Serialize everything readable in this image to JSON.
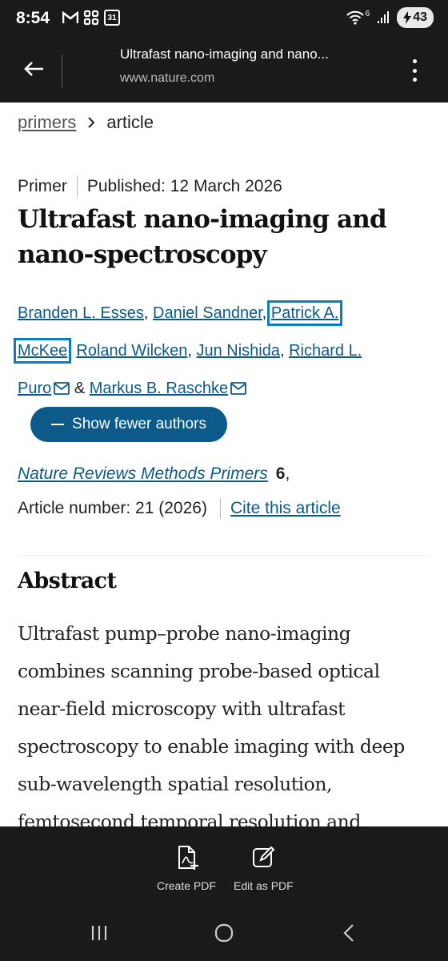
{
  "status_bar": {
    "time": "8:54",
    "left_icons": [
      "gmail-icon",
      "slack-icon",
      "calendar-icon"
    ],
    "calendar_day": "31",
    "signal_label": "6",
    "battery_level": "43"
  },
  "app_bar": {
    "title": "Ultrafast nano-imaging and nano...",
    "url": "www.nature.com"
  },
  "breadcrumb": {
    "parent": "primers",
    "current": "article"
  },
  "article": {
    "type": "Primer",
    "published": "Published: 12 March 2026",
    "title": "Ultrafast nano-imaging and nano-spectroscopy",
    "authors": [
      "Branden L. Esses",
      "Daniel Sandner",
      "Patrick A.",
      "McKee",
      "Roland Wilcken",
      "Jun Nishida",
      "Richard L.",
      "Puro",
      "Markus B. Raschke"
    ],
    "separators": {
      "comma": ",",
      "amp": "&"
    },
    "show_authors_label": "Show fewer authors",
    "journal": "Nature Reviews Methods Primers",
    "volume": "6",
    "volume_suffix": ",",
    "article_number": "Article number: 21 (2026)",
    "cite_label": "Cite this article"
  },
  "abstract": {
    "heading": "Abstract",
    "lines": [
      "Ultrafast pump–probe nano-imaging",
      "combines scanning probe-based optical",
      "near-field microscopy with ultrafast",
      "spectroscopy to enable imaging with deep",
      "sub-wavelength spatial resolution,",
      "femtosecond temporal resolution and"
    ]
  },
  "toolbar": {
    "create_pdf": "Create PDF",
    "edit_pdf": "Edit as PDF"
  },
  "colors": {
    "link": "#0b5a8a",
    "focus_outline": "#0b7bc4",
    "dark_bar": "#1a1a1a"
  }
}
